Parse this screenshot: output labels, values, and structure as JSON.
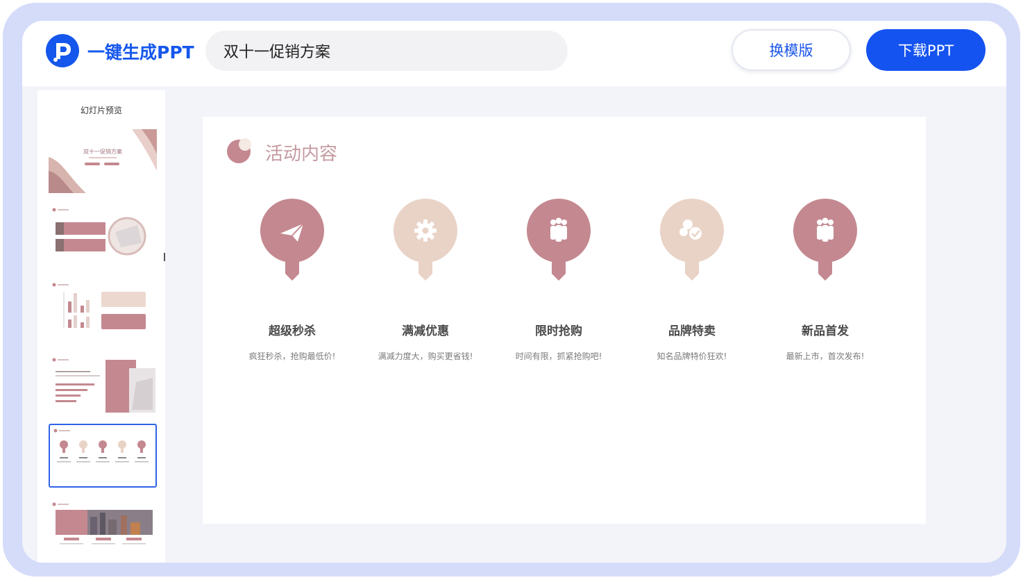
{
  "app": {
    "title": "一键生成PPT",
    "logo_icon": "p-logo-icon"
  },
  "header": {
    "doc_title": "双十一促销方案",
    "change_template_label": "换模版",
    "download_label": "下载PPT"
  },
  "sidebar": {
    "title": "幻灯片预览",
    "cover_title": "双十一促销方案",
    "active_index": 4
  },
  "slide": {
    "heading": "活动内容",
    "items": [
      {
        "title": "超级秒杀",
        "desc": "疯狂秒杀，抢购最低价!",
        "icon": "paper-plane-icon",
        "color": "#c48890"
      },
      {
        "title": "满减优惠",
        "desc": "满减力度大，购买更省钱!",
        "icon": "gear-icon",
        "color": "#e9d3c6"
      },
      {
        "title": "限时抢购",
        "desc": "时间有限，抓紧抢购吧!",
        "icon": "people-icon",
        "color": "#c48890"
      },
      {
        "title": "品牌特卖",
        "desc": "知名品牌特价狂欢!",
        "icon": "coins-icon",
        "color": "#e9d3c6"
      },
      {
        "title": "新品首发",
        "desc": "最新上市，首次发布!",
        "icon": "people-icon",
        "color": "#c48890"
      }
    ]
  },
  "colors": {
    "brand_blue": "#1557ec",
    "rose": "#c48890",
    "beige": "#e9d3c6",
    "heading": "#c49aa0"
  }
}
